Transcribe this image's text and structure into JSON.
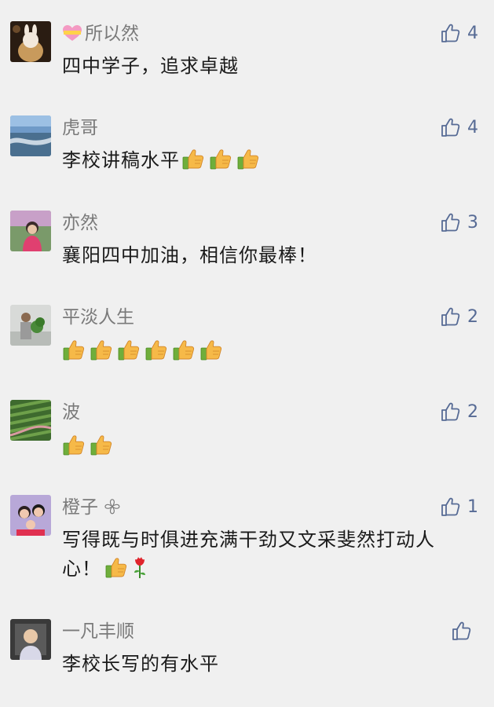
{
  "comments": [
    {
      "name": "所以然",
      "text": "四中学子，追求卓越",
      "likes": "4",
      "avatar": "avatar-bunny"
    },
    {
      "name": "虎哥",
      "text": "李校讲稿水平",
      "likes": "4",
      "avatar": "avatar-river"
    },
    {
      "name": "亦然",
      "text": "襄阳四中加油，相信你最棒！",
      "likes": "3",
      "avatar": "avatar-woman"
    },
    {
      "name": "平淡人生",
      "text": "",
      "likes": "2",
      "avatar": "avatar-man"
    },
    {
      "name": "波",
      "text": "",
      "likes": "2",
      "avatar": "avatar-field"
    },
    {
      "name": "橙子 𖧷",
      "text": "写得既与时俱进充满干劲又文采斐然打动人心！",
      "likes": "1",
      "avatar": "avatar-family"
    },
    {
      "name": "一凡丰顺",
      "text": "李校长写的有水平",
      "likes": "",
      "avatar": "avatar-baby"
    }
  ],
  "icons": {
    "like": "thumbs-up-outline-icon",
    "emoji": "thumbs-up-emoji",
    "rose": "rose-emoji",
    "heart": "heart-ribbon-emoji"
  },
  "colors": {
    "like": "#576b95",
    "name": "#7a7a7a",
    "background": "#f0f0f0"
  }
}
